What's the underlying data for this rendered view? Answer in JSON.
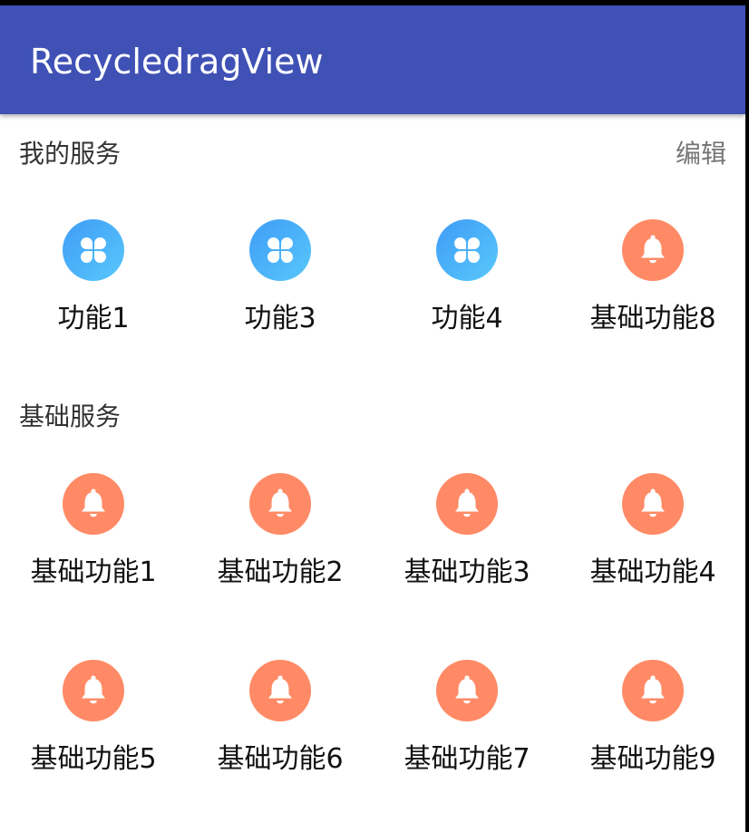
{
  "app": {
    "title": "RecycledragView"
  },
  "my_services": {
    "title": "我的服务",
    "edit_label": "编辑",
    "items": [
      {
        "label": "功能1",
        "icon": "clover-icon"
      },
      {
        "label": "功能3",
        "icon": "clover-icon"
      },
      {
        "label": "功能4",
        "icon": "clover-icon"
      },
      {
        "label": "基础功能8",
        "icon": "bell-icon"
      }
    ]
  },
  "basic_services": {
    "title": "基础服务",
    "items": [
      {
        "label": "基础功能1",
        "icon": "bell-icon"
      },
      {
        "label": "基础功能2",
        "icon": "bell-icon"
      },
      {
        "label": "基础功能3",
        "icon": "bell-icon"
      },
      {
        "label": "基础功能4",
        "icon": "bell-icon"
      },
      {
        "label": "基础功能5",
        "icon": "bell-icon"
      },
      {
        "label": "基础功能6",
        "icon": "bell-icon"
      },
      {
        "label": "基础功能7",
        "icon": "bell-icon"
      },
      {
        "label": "基础功能9",
        "icon": "bell-icon"
      }
    ]
  },
  "colors": {
    "appbar": "#3f51b5",
    "clover_gradient_start": "#3f9cf7",
    "clover_gradient_end": "#58c8fb",
    "bell": "#ff8a65"
  }
}
